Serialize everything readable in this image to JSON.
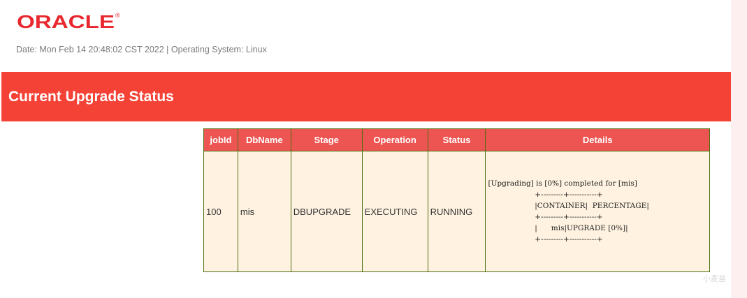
{
  "logo": {
    "text": "ORACLE",
    "registered_mark": "®",
    "color": "#e8272f"
  },
  "header": {
    "date_line": "Date: Mon Feb 14 20:48:02 CST 2022 | Operating System: Linux"
  },
  "banner": {
    "title": "Current Upgrade Status",
    "color": "#f54236"
  },
  "table": {
    "columns": [
      "jobId",
      "DbName",
      "Stage",
      "Operation",
      "Status",
      "Details"
    ],
    "rows": [
      {
        "jobId": "100",
        "DbName": "mis",
        "Stage": "DBUPGRADE",
        "Operation": "EXECUTING",
        "Status": "RUNNING",
        "Details": "[Upgrading] is [0%] completed for [mis]\n                    +---------+-----------+\n                    |CONTAINER|  PERCENTAGE|\n                    +---------+-----------+\n                    |      mis|UPGRADE [0%]|\n                    +---------+-----------+"
      }
    ],
    "header_color": "#ed5552",
    "cell_color": "#fff2e0",
    "border_color": "#4a6e10"
  },
  "watermark": {
    "text": "小麦苗"
  }
}
